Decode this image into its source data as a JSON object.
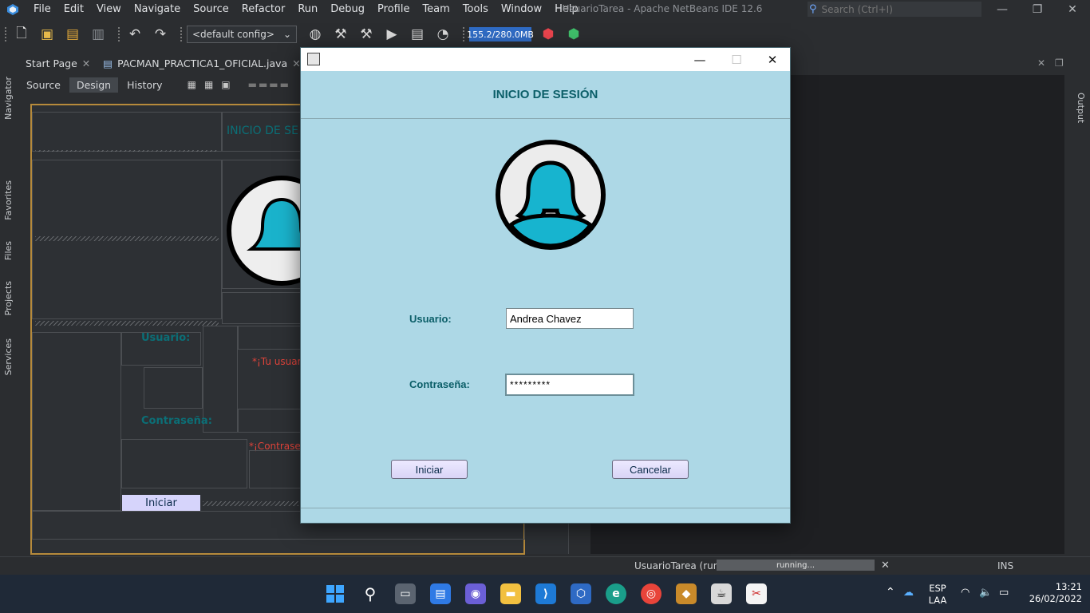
{
  "menubar": {
    "items": [
      "File",
      "Edit",
      "View",
      "Navigate",
      "Source",
      "Refactor",
      "Run",
      "Debug",
      "Profile",
      "Team",
      "Tools",
      "Window",
      "Help"
    ],
    "title": "UsuarioTarea - Apache NetBeans IDE 12.6",
    "search_placeholder": "Search (Ctrl+I)"
  },
  "toolbar": {
    "config": "<default config>",
    "memory": "155.2/280.0MB"
  },
  "sidebar": {
    "left_tabs": [
      "Navigator",
      "Favorites",
      "Files",
      "Projects",
      "Services"
    ],
    "right_tabs": [
      "Output"
    ]
  },
  "editor": {
    "tabs": [
      "Start Page",
      "PACMAN_PRACTICA1_OFICIAL.java"
    ],
    "subtabs": [
      "Source",
      "Design",
      "History"
    ],
    "ghost": {
      "heading": "INICIO DE SE",
      "user_label": "Usuario:",
      "user_error": "*¡Tu usuario",
      "pass_label": "Contraseña:",
      "pass_error": "*¡Contraseña",
      "start_button": "Iniciar"
    }
  },
  "dialog": {
    "heading": "INICIO DE SESIÓN",
    "user_label": "Usuario:",
    "user_value": "Andrea Chavez",
    "password_label": "Contraseña:",
    "password_value": "*********",
    "start_button": "Iniciar",
    "cancel_button": "Cancelar",
    "avatar_icon": "user-avatar-icon",
    "colors": {
      "background": "#add8e6",
      "accent": "#0b5e68"
    }
  },
  "status": {
    "run_label": "UsuarioTarea (run)",
    "run_state": "running...",
    "ins": "INS"
  },
  "taskbar": {
    "lang_top": "ESP",
    "lang_bottom": "LAA",
    "time": "13:21",
    "date": "26/02/2022"
  }
}
